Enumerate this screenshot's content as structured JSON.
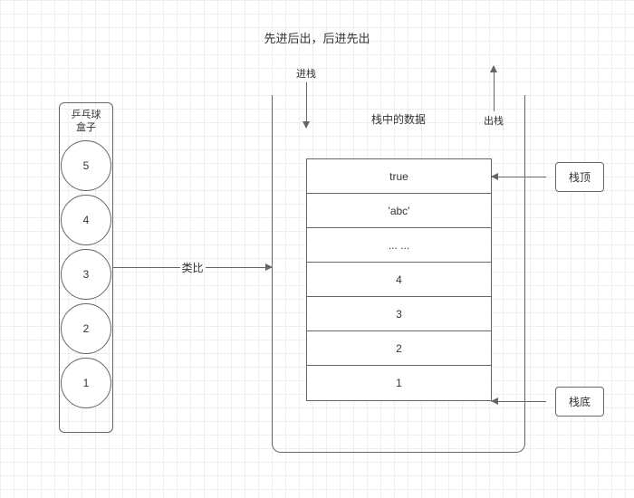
{
  "title": "先进后出，后进先出",
  "ballBox": {
    "label_line1": "乒乓球",
    "label_line2": "盒子",
    "balls": [
      "5",
      "4",
      "3",
      "2",
      "1"
    ]
  },
  "analogy": {
    "label": "类比"
  },
  "stack": {
    "pushLabel": "进栈",
    "popLabel": "出栈",
    "title": "栈中的数据",
    "cells": [
      "true",
      "'abc'",
      "... ...",
      "4",
      "3",
      "2",
      "1"
    ],
    "topLabel": "栈顶",
    "bottomLabel": "栈底"
  }
}
